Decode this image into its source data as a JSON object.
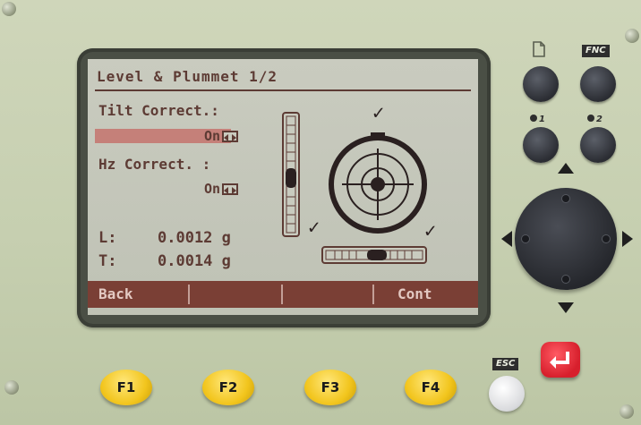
{
  "screen": {
    "title": "Level & Plummet 1/2",
    "tilt_label": "Tilt Correct.:",
    "tilt_value": "On",
    "hz_label": "Hz Correct.   :",
    "hz_value": "On",
    "l_label": "L:",
    "l_value": "0.0012 g",
    "t_label": "T:",
    "t_value": "0.0014 g",
    "check_mark": "✓"
  },
  "softkeys": [
    "Back",
    "",
    "",
    "Cont"
  ],
  "hard_keys": {
    "f1": "F1",
    "f2": "F2",
    "f3": "F3",
    "f4": "F4",
    "esc_label": "ESC",
    "fnc_label": "FNC",
    "user1_label": "1",
    "user2_label": "2"
  },
  "colors": {
    "lcd_text": "#5d3b34",
    "softkey_bar": "#7a3f35",
    "fkey_yellow": "#f2c51d",
    "enter_red": "#d71f2c"
  }
}
